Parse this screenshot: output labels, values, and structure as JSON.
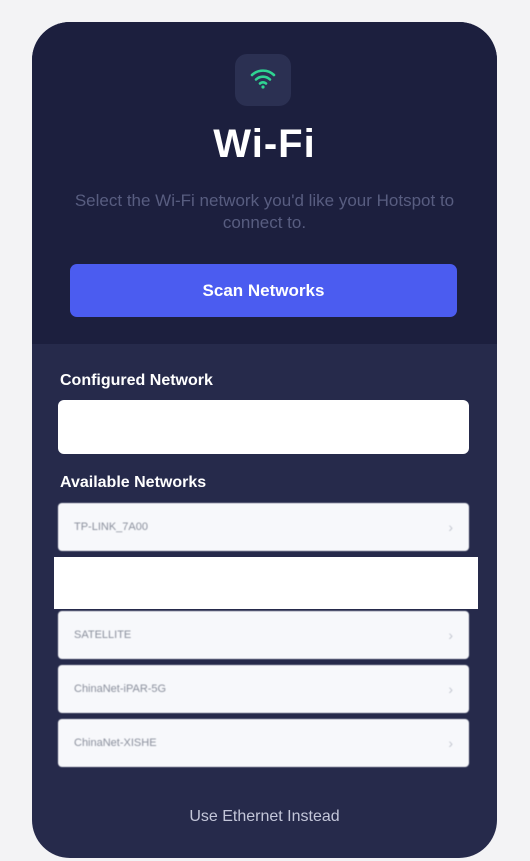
{
  "header": {
    "icon": "wifi-icon",
    "title": "Wi-Fi",
    "subtitle": "Select the Wi-Fi network you'd like your Hotspot to connect to.",
    "scan_label": "Scan Networks"
  },
  "configured": {
    "label": "Configured Network",
    "value": ""
  },
  "available": {
    "label": "Available Networks",
    "networks": [
      {
        "ssid": "TP-LINK_7A00"
      },
      {
        "ssid": ""
      },
      {
        "ssid": "SATELLITE"
      },
      {
        "ssid": "ChinaNet-iPAR-5G"
      },
      {
        "ssid": "ChinaNet-XISHE"
      }
    ]
  },
  "footer": {
    "ethernet_label": "Use Ethernet Instead"
  },
  "colors": {
    "card_bg": "#262a4b",
    "top_panel_bg": "#1c1f3e",
    "accent": "#4b5cf0",
    "wifi_icon": "#2fd592"
  }
}
